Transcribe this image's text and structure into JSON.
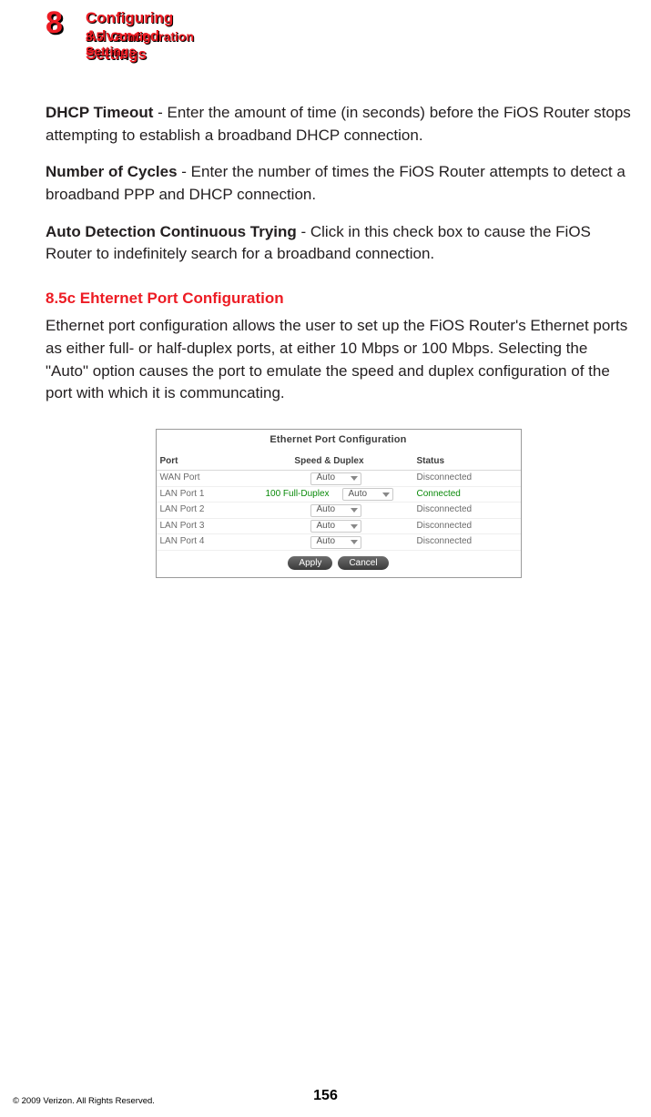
{
  "header": {
    "chapter_number": "8",
    "chapter_title": "Configuring Advanced Settings",
    "section_number": "8.5",
    "section_title": "Configuration Settings"
  },
  "body": {
    "p1": {
      "lead": "DHCP Timeout",
      "text": " - Enter the amount of time (in seconds) before the FiOS Router stops attempting to establish a broadband DHCP connection."
    },
    "p2": {
      "lead": "Number of Cycles",
      "text": " - Enter the number of times the FiOS Router attempts to detect a broadband PPP and DHCP connection."
    },
    "p3": {
      "lead": "Auto Detection Continuous Trying",
      "text": " - Click in this check box to cause the FiOS Router to indefinitely search for a broadband connection."
    },
    "subhead": "8.5c  Ehternet Port Configuration",
    "p4": "Ethernet port configuration allows the user to set up the FiOS Router's Ethernet ports as either full- or half-duplex ports, at either 10 Mbps or 100 Mbps. Selecting the \"Auto\" option causes the port to emulate the speed and duplex configuration of the port with which it is communcating."
  },
  "figure": {
    "title": "Ethernet Port Configuration",
    "columns": {
      "port": "Port",
      "speed": "Speed & Duplex",
      "status": "Status"
    },
    "rows": [
      {
        "port": "WAN Port",
        "linkspeed": "",
        "dropdown": "Auto",
        "status": "Disconnected",
        "connected": false
      },
      {
        "port": "LAN Port 1",
        "linkspeed": "100 Full-Duplex",
        "dropdown": "Auto",
        "status": "Connected",
        "connected": true
      },
      {
        "port": "LAN Port 2",
        "linkspeed": "",
        "dropdown": "Auto",
        "status": "Disconnected",
        "connected": false
      },
      {
        "port": "LAN Port 3",
        "linkspeed": "",
        "dropdown": "Auto",
        "status": "Disconnected",
        "connected": false
      },
      {
        "port": "LAN Port 4",
        "linkspeed": "",
        "dropdown": "Auto",
        "status": "Disconnected",
        "connected": false
      }
    ],
    "buttons": {
      "apply": "Apply",
      "cancel": "Cancel"
    }
  },
  "footer": {
    "page_number": "156",
    "copyright": "© 2009 Verizon. All Rights Reserved."
  }
}
